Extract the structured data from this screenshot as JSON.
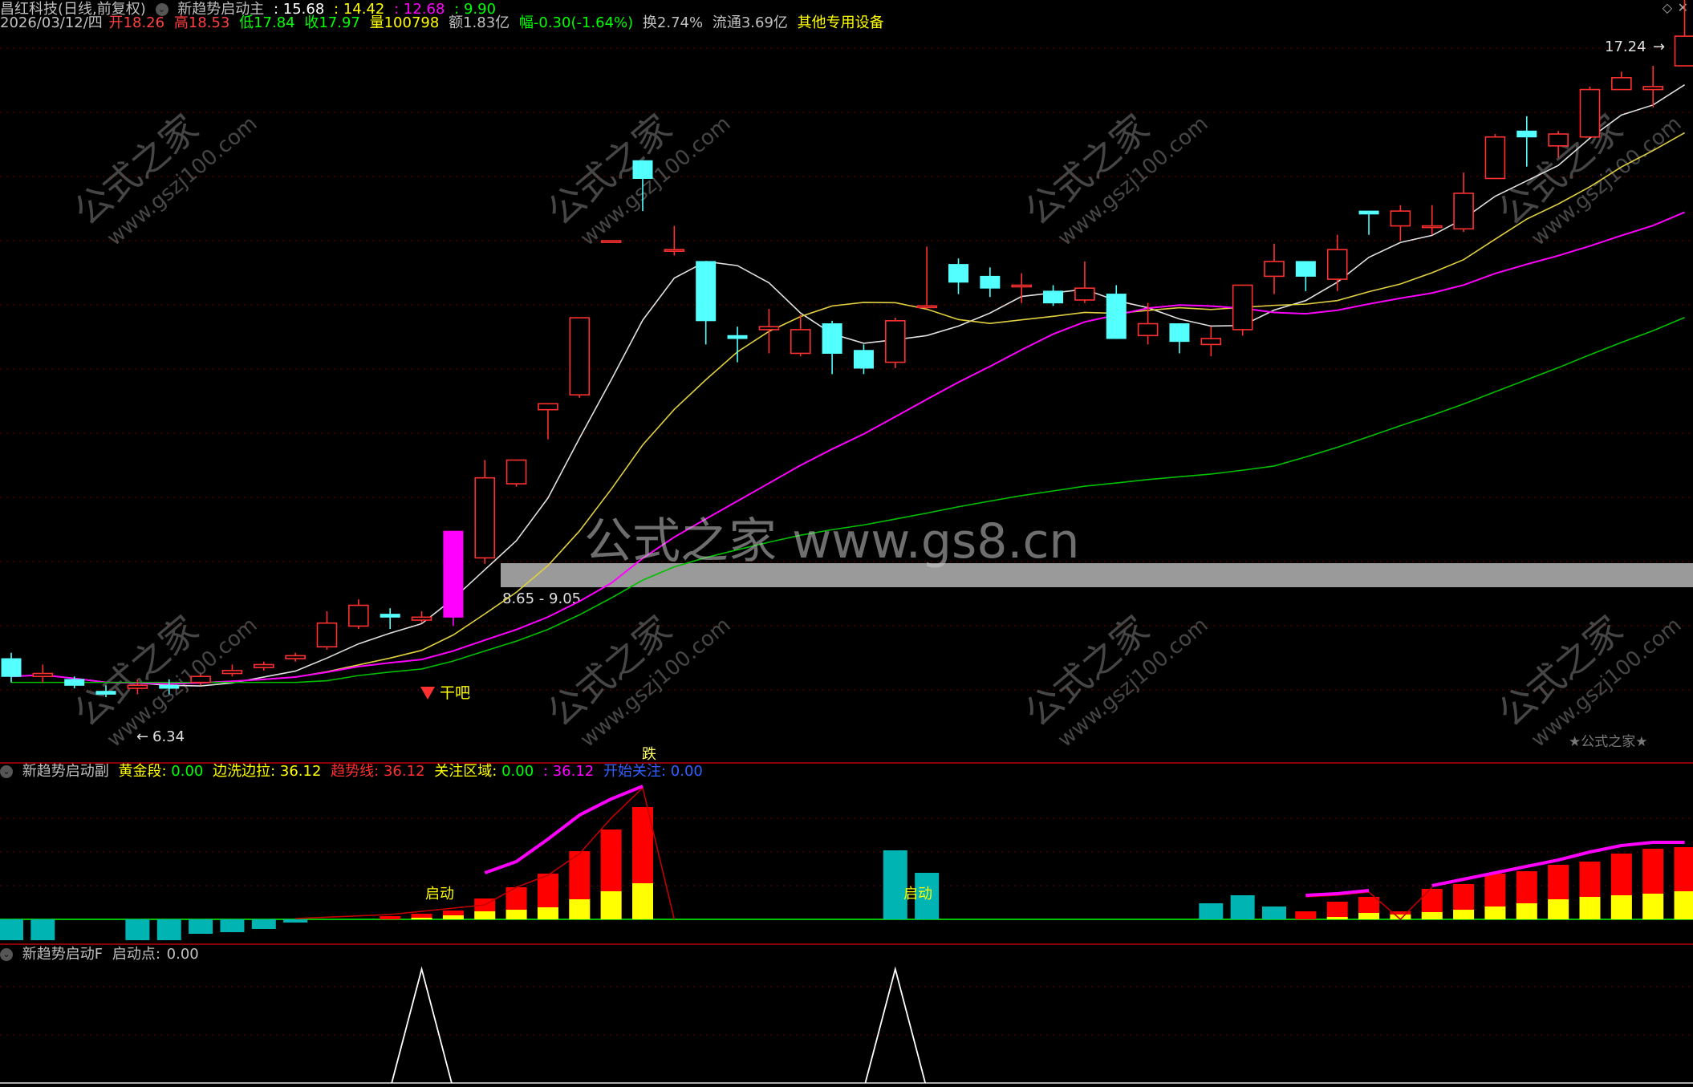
{
  "title": {
    "stock": "昌红科技(日线,前复权)",
    "indicator": "新趋势启动主",
    "values": [
      ": 15.68",
      ": 14.42",
      ": 12.68",
      ": 9.90"
    ]
  },
  "info": {
    "date": "2026/03/12/四",
    "open": "开18.26",
    "high": "高18.53",
    "low": "低17.84",
    "close": "收17.97",
    "volume": "量100798",
    "amount": "额1.83亿",
    "change": "幅-0.30(-1.64%)",
    "turnover": "换2.74%",
    "float": "流通3.69亿",
    "sector": "其他专用设备"
  },
  "main_chart": {
    "price_high_label": "17.24",
    "price_low_label": "6.34",
    "zone_label": "8.65 - 9.05",
    "signal_label": "干吧",
    "fall_label": "跌",
    "watermark_center": "公式之家 www.gs8.cn",
    "watermark_tile_cn": "公式之家",
    "watermark_tile_url": "www.gszj100.com",
    "corner_badge": "★公式之家★"
  },
  "sub1": {
    "name": "新趋势启动副",
    "fields": [
      {
        "label": "黄金段:",
        "value": "0.00",
        "color": "#ffff00"
      },
      {
        "label": "边洗边拉:",
        "value": "36.12",
        "color": "#ffff00"
      },
      {
        "label": "趋势线:",
        "value": "36.12",
        "color": "#ff3030"
      },
      {
        "label": "关注区域:",
        "value": "0.00",
        "color": "#00ff00"
      },
      {
        "label": ":",
        "value": "36.12",
        "color": "#ff00ff"
      },
      {
        "label": "开始关注:",
        "value": "0.00",
        "color": "#3060ff"
      }
    ],
    "start_label_1": "启动",
    "start_label_2": "启动"
  },
  "sub2": {
    "name": "新趋势启动F",
    "field_label": "启动点:",
    "field_value": "0.00"
  },
  "colors": {
    "up": "#ff3030",
    "down": "#54ffff",
    "ma5": "#e0e0e0",
    "ma10": "#e0d040",
    "ma20": "#ff00ff",
    "ma60": "#00c000",
    "yellow": "#ffff00",
    "red": "#ff0000",
    "cyan_bar": "#00b4b4"
  },
  "chart_data": {
    "type": "candlestick",
    "candles": [
      {
        "o": 7.3,
        "c": 7.0,
        "h": 7.4,
        "l": 6.9
      },
      {
        "o": 7.0,
        "c": 7.05,
        "h": 7.2,
        "l": 6.9
      },
      {
        "o": 6.95,
        "c": 6.85,
        "h": 7.0,
        "l": 6.8
      },
      {
        "o": 6.75,
        "c": 6.7,
        "h": 6.85,
        "l": 6.65
      },
      {
        "o": 6.8,
        "c": 6.85,
        "h": 6.95,
        "l": 6.7
      },
      {
        "o": 6.85,
        "c": 6.8,
        "h": 6.95,
        "l": 6.7
      },
      {
        "o": 6.9,
        "c": 7.0,
        "h": 7.05,
        "l": 6.85
      },
      {
        "o": 7.05,
        "c": 7.1,
        "h": 7.2,
        "l": 7.0
      },
      {
        "o": 7.15,
        "c": 7.2,
        "h": 7.25,
        "l": 7.1
      },
      {
        "o": 7.3,
        "c": 7.35,
        "h": 7.4,
        "l": 7.25
      },
      {
        "o": 7.5,
        "c": 7.9,
        "h": 8.1,
        "l": 7.45
      },
      {
        "o": 7.85,
        "c": 8.2,
        "h": 8.3,
        "l": 7.8
      },
      {
        "o": 8.05,
        "c": 8.0,
        "h": 8.15,
        "l": 7.8
      },
      {
        "o": 7.95,
        "c": 8.0,
        "h": 8.1,
        "l": 7.9
      },
      {
        "o": 8.0,
        "c": 9.45,
        "h": 9.45,
        "l": 7.85
      },
      {
        "o": 9.0,
        "c": 10.35,
        "h": 10.65,
        "l": 8.9
      },
      {
        "o": 10.25,
        "c": 10.65,
        "h": 10.65,
        "l": 10.2
      },
      {
        "o": 11.5,
        "c": 11.6,
        "h": 11.6,
        "l": 11.0
      },
      {
        "o": 11.75,
        "c": 13.05,
        "h": 13.05,
        "l": 11.7
      },
      {
        "o": 14.35,
        "c": 14.35,
        "h": 14.35,
        "l": 14.35
      },
      {
        "o": 15.7,
        "c": 15.4,
        "h": 15.7,
        "l": 14.85
      },
      {
        "o": 14.2,
        "c": 14.2,
        "h": 14.6,
        "l": 14.1
      },
      {
        "o": 14.0,
        "c": 13.0,
        "h": 14.0,
        "l": 12.6
      },
      {
        "o": 12.75,
        "c": 12.7,
        "h": 12.9,
        "l": 12.3
      },
      {
        "o": 12.85,
        "c": 12.9,
        "h": 13.2,
        "l": 12.45
      },
      {
        "o": 12.45,
        "c": 12.85,
        "h": 13.1,
        "l": 12.4
      },
      {
        "o": 12.95,
        "c": 12.45,
        "h": 13.0,
        "l": 12.1
      },
      {
        "o": 12.5,
        "c": 12.2,
        "h": 12.6,
        "l": 12.1
      },
      {
        "o": 12.3,
        "c": 13.0,
        "h": 13.05,
        "l": 12.2
      },
      {
        "o": 13.25,
        "c": 13.25,
        "h": 14.25,
        "l": 13.2
      },
      {
        "o": 13.95,
        "c": 13.65,
        "h": 14.05,
        "l": 13.45
      },
      {
        "o": 13.75,
        "c": 13.55,
        "h": 13.9,
        "l": 13.4
      },
      {
        "o": 13.6,
        "c": 13.6,
        "h": 13.8,
        "l": 13.3
      },
      {
        "o": 13.5,
        "c": 13.3,
        "h": 13.6,
        "l": 13.25
      },
      {
        "o": 13.35,
        "c": 13.55,
        "h": 14.0,
        "l": 13.3
      },
      {
        "o": 13.45,
        "c": 12.7,
        "h": 13.6,
        "l": 12.75
      },
      {
        "o": 12.75,
        "c": 12.95,
        "h": 13.3,
        "l": 12.6
      },
      {
        "o": 12.95,
        "c": 12.65,
        "h": 12.95,
        "l": 12.45
      },
      {
        "o": 12.6,
        "c": 12.7,
        "h": 12.9,
        "l": 12.4
      },
      {
        "o": 12.85,
        "c": 13.6,
        "h": 13.6,
        "l": 12.75
      },
      {
        "o": 13.75,
        "c": 14.0,
        "h": 14.3,
        "l": 13.45
      },
      {
        "o": 14.0,
        "c": 13.75,
        "h": 14.0,
        "l": 13.5
      },
      {
        "o": 13.7,
        "c": 14.2,
        "h": 14.45,
        "l": 13.5
      },
      {
        "o": 14.85,
        "c": 14.8,
        "h": 14.85,
        "l": 14.45
      },
      {
        "o": 14.6,
        "c": 14.85,
        "h": 14.95,
        "l": 14.35
      },
      {
        "o": 14.6,
        "c": 14.6,
        "h": 14.95,
        "l": 14.45
      },
      {
        "o": 14.55,
        "c": 15.15,
        "h": 15.5,
        "l": 14.5
      },
      {
        "o": 15.4,
        "c": 16.1,
        "h": 16.15,
        "l": 15.4
      },
      {
        "o": 16.2,
        "c": 16.1,
        "h": 16.45,
        "l": 15.6
      },
      {
        "o": 15.95,
        "c": 16.15,
        "h": 16.2,
        "l": 15.75
      },
      {
        "o": 16.1,
        "c": 16.9,
        "h": 16.95,
        "l": 16.1
      },
      {
        "o": 16.9,
        "c": 17.1,
        "h": 17.2,
        "l": 16.9
      },
      {
        "o": 16.9,
        "c": 16.95,
        "h": 17.3,
        "l": 16.6
      },
      {
        "o": 17.3,
        "c": 17.8,
        "h": 18.53,
        "l": 17.3
      }
    ]
  }
}
